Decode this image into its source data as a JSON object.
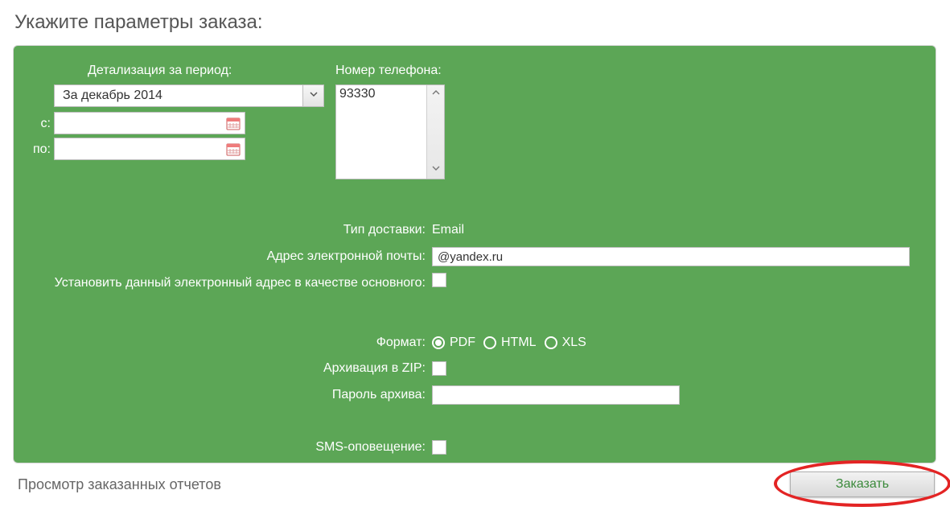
{
  "page": {
    "title": "Укажите параметры заказа:"
  },
  "period": {
    "label": "Детализация за период:",
    "selected": "За декабрь 2014",
    "from_label": "с:",
    "to_label": "по:",
    "from_value": "",
    "to_value": ""
  },
  "phone": {
    "label": "Номер телефона:",
    "items": [
      "93330"
    ]
  },
  "delivery": {
    "type_label": "Тип доставки:",
    "type_value": "Email",
    "email_label": "Адрес электронной почты:",
    "email_value": "@yandex.ru",
    "set_main_label": "Установить данный электронный адрес в качестве основного:",
    "set_main_checked": false
  },
  "format": {
    "label": "Формат:",
    "options": [
      {
        "label": "PDF",
        "selected": true
      },
      {
        "label": "HTML",
        "selected": false
      },
      {
        "label": "XLS",
        "selected": false
      }
    ],
    "zip_label": "Архивация в ZIP:",
    "zip_checked": false,
    "archpw_label": "Пароль архива:",
    "archpw_value": ""
  },
  "sms": {
    "label": "SMS-оповещение:",
    "checked": false
  },
  "footer": {
    "view_reports": "Просмотр заказанных отчетов",
    "order_button": "Заказать"
  }
}
